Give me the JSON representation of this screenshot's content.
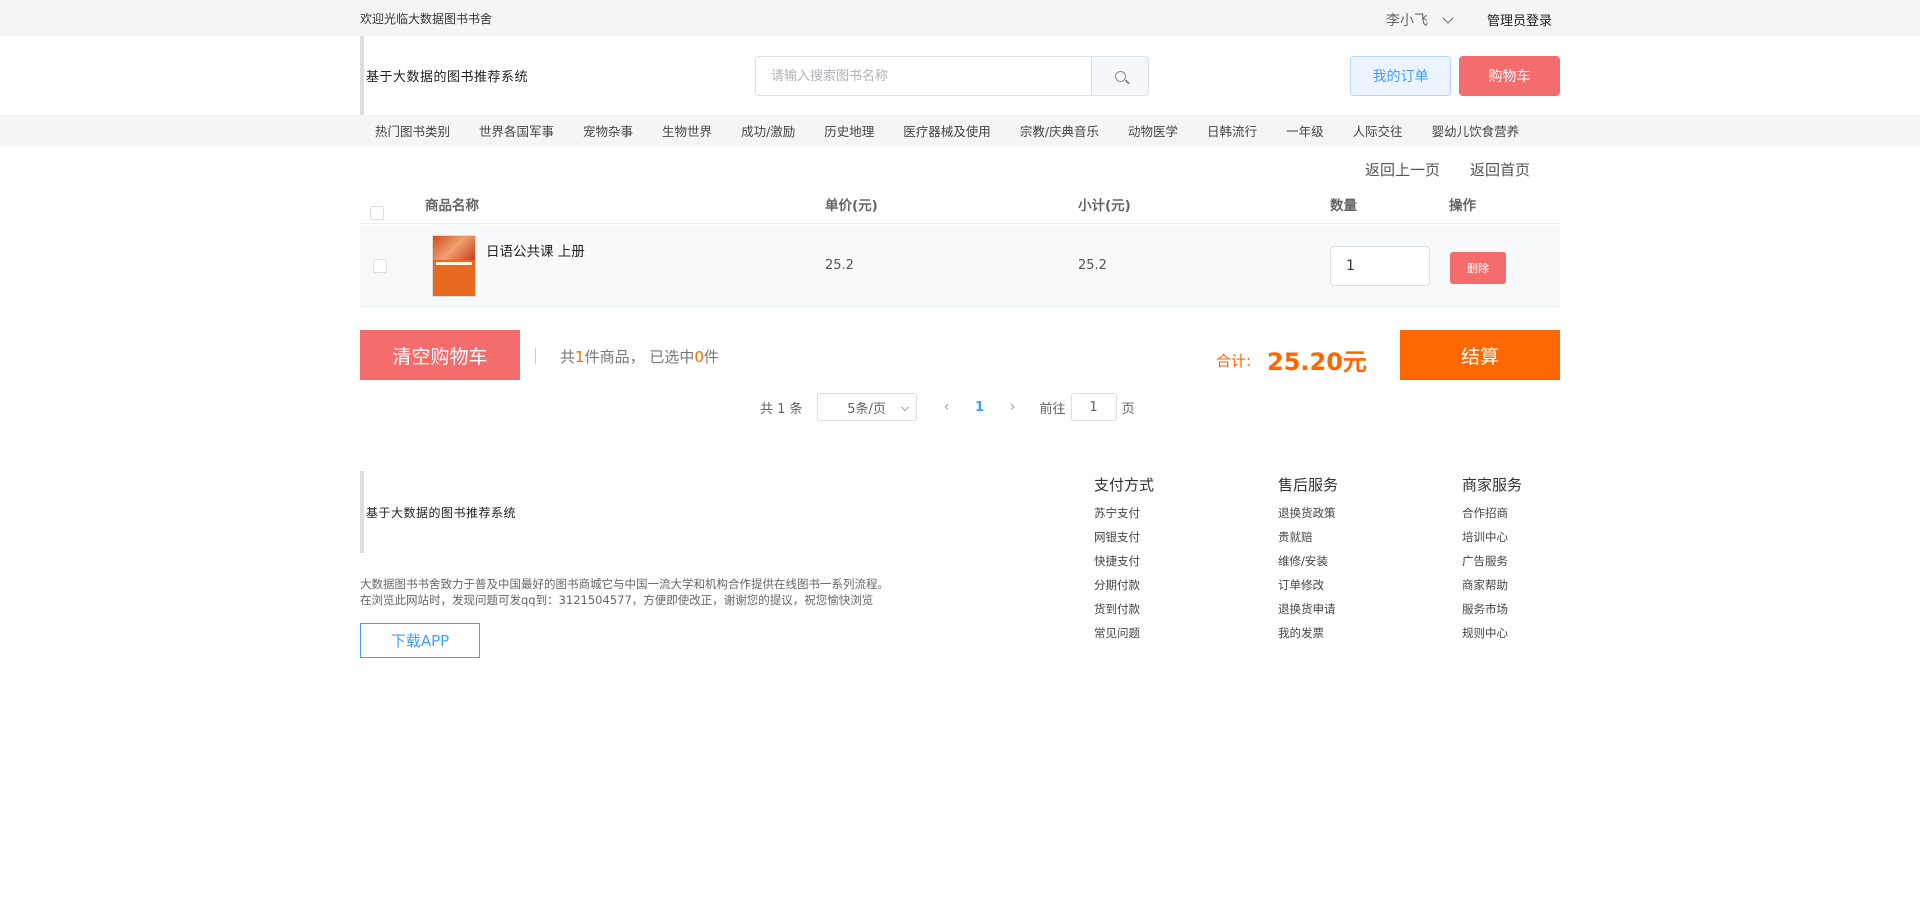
{
  "topbar": {
    "welcome": "欢迎光临大数据图书书舍",
    "user": "李小飞",
    "admin_login": "管理员登录"
  },
  "header": {
    "logo": "基于大数据的图书推荐系统",
    "search_placeholder": "请输入搜索图书名称",
    "my_orders": "我的订单",
    "cart": "购物车"
  },
  "categories": [
    "热门图书类别",
    "世界各国军事",
    "宠物杂事",
    "生物世界",
    "成功/激励",
    "历史地理",
    "医疗器械及使用",
    "宗教/庆典音乐",
    "动物医学",
    "日韩流行",
    "一年级",
    "人际交往",
    "婴幼儿饮食营养"
  ],
  "cart": {
    "back_prev": "返回上一页",
    "back_home": "返回首页",
    "headers": {
      "name": "商品名称",
      "price": "单价(元)",
      "subtotal": "小计(元)",
      "qty": "数量",
      "action": "操作"
    },
    "items": [
      {
        "name": "日语公共课 上册",
        "price": "25.2",
        "subtotal": "25.2",
        "qty": "1",
        "delete": "删除"
      }
    ],
    "clear": "清空购物车",
    "count_prefix": "共",
    "count_total": "1",
    "count_mid": "件商品，  已选中",
    "count_selected": "0",
    "count_suffix": "件",
    "total_label": "合计:",
    "total_value": "25.20元",
    "checkout": "结算"
  },
  "pagination": {
    "total": "共 1 条",
    "page_size": "5条/页",
    "prev": "‹",
    "page": "1",
    "next": "›",
    "goto_label": "前往",
    "goto_value": "1",
    "goto_suffix": "页"
  },
  "footer": {
    "logo": "基于大数据的图书推荐系统",
    "desc_line1": "大数据图书书舍致力于普及中国最好的图书商城它与中国一流大学和机构合作提供在线图书一系列流程。",
    "desc_line2": "在浏览此网站时，发现问题可发qq到：3121504577，方便即使改正，谢谢您的提议，祝您愉快浏览",
    "download_app": "下载APP",
    "columns": [
      {
        "title": "支付方式",
        "links": [
          "苏宁支付",
          "网银支付",
          "快捷支付",
          "分期付款",
          "货到付款",
          "常见问题"
        ]
      },
      {
        "title": "售后服务",
        "links": [
          "退换货政策",
          "贵就赔",
          "维修/安装",
          "订单修改",
          "退换货申请",
          "我的发票"
        ]
      },
      {
        "title": "商家服务",
        "links": [
          "合作招商",
          "培训中心",
          "广告服务",
          "商家帮助",
          "服务市场",
          "规则中心"
        ]
      }
    ]
  },
  "colors": {
    "danger": "#f56c6c",
    "primary": "#409eff",
    "accent_orange": "#ff6700"
  }
}
